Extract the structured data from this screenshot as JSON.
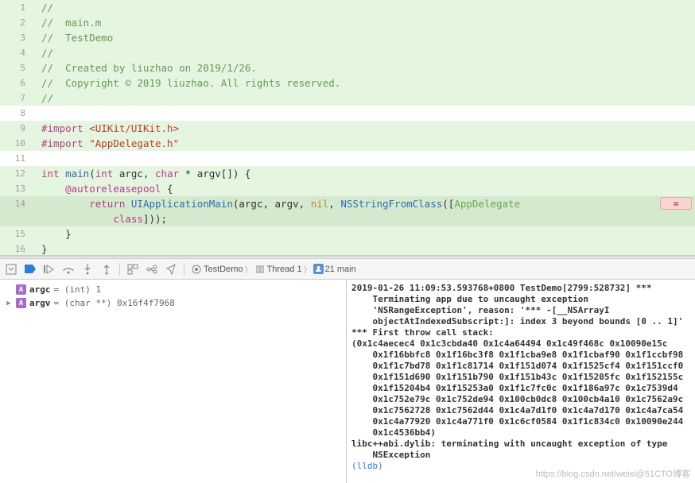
{
  "code": {
    "lines": [
      {
        "n": 1,
        "cls": "green",
        "html": "<span class='comment'>//</span>"
      },
      {
        "n": 2,
        "cls": "green",
        "html": "<span class='comment'>//  main.m</span>"
      },
      {
        "n": 3,
        "cls": "green",
        "html": "<span class='comment'>//  TestDemo</span>"
      },
      {
        "n": 4,
        "cls": "green",
        "html": "<span class='comment'>//</span>"
      },
      {
        "n": 5,
        "cls": "green",
        "html": "<span class='comment'>//  Created by liuzhao on 2019/1/26.</span>"
      },
      {
        "n": 6,
        "cls": "green",
        "html": "<span class='comment'>//  Copyright © 2019 liuzhao. All rights reserved.</span>"
      },
      {
        "n": 7,
        "cls": "green",
        "html": "<span class='comment'>//</span>"
      },
      {
        "n": 8,
        "cls": "",
        "html": ""
      },
      {
        "n": 9,
        "cls": "green",
        "html": "<span class='keyword'>#import</span> <span class='string'>&lt;UIKit/UIKit.h&gt;</span>"
      },
      {
        "n": 10,
        "cls": "green",
        "html": "<span class='keyword'>#import</span> <span class='string'>\"AppDelegate.h\"</span>"
      },
      {
        "n": 11,
        "cls": "",
        "html": ""
      },
      {
        "n": 12,
        "cls": "green",
        "html": "<span class='keyword'>int</span> <span class='func'>main</span>(<span class='keyword'>int</span> argc, <span class='keyword'>char</span> * argv[]) {"
      },
      {
        "n": 13,
        "cls": "green",
        "html": "    <span class='keyword'>@autoreleasepool</span> {"
      },
      {
        "n": 14,
        "cls": "highlight",
        "html": "        <span class='keyword'>return</span> <span class='func'>UIApplicationMain</span>(argc, argv, <span class='kw2'>nil</span>, <span class='func'>NSStringFromClass</span>([<span class='cls'>AppDelegate</span>",
        "err": true
      },
      {
        "n": "",
        "cls": "highlight",
        "html": "            <span class='keyword'>class</span>]));"
      },
      {
        "n": 15,
        "cls": "green",
        "html": "    }"
      },
      {
        "n": 16,
        "cls": "green",
        "html": "}"
      }
    ],
    "err_symbol": "="
  },
  "breadcrumb": {
    "app": "TestDemo",
    "thread": "Thread 1",
    "frame": "21 main"
  },
  "vars": [
    {
      "arrow": "",
      "name": "argc",
      "type": " = (int) ",
      "val": "1"
    },
    {
      "arrow": "▶",
      "name": "argv",
      "type": " = (char **) ",
      "val": "0x16f4f7968"
    }
  ],
  "console": [
    "<b>2019-01-26 11:09:53.593768+0800 TestDemo[2799:528732] ***</b>",
    "<b>    Terminating app due to uncaught exception</b>",
    "<b>    'NSRangeException', reason: '*** -[__NSArrayI</b>",
    "<b>    objectAtIndexedSubscript:]: index 3 beyond bounds [0 .. 1]'</b>",
    "<b>*** First throw call stack:</b>",
    "<b>(0x1c4aecec4 0x1c3cbda40 0x1c4a64494 0x1c49f468c 0x10090e15c</b>",
    "<b>    0x1f16bbfc8 0x1f16bc3f8 0x1f1cba9e8 0x1f1cbaf90 0x1f1ccbf98</b>",
    "<b>    0x1f1c7bd78 0x1f1c81714 0x1f151d074 0x1f1525cf4 0x1f151ccf0</b>",
    "<b>    0x1f151d690 0x1f151b790 0x1f151b43c 0x1f15205fc 0x1f152155c</b>",
    "<b>    0x1f15204b4 0x1f15253a0 0x1f1c7fc0c 0x1f186a97c 0x1c7539d4</b>",
    "<b>    0x1c752e79c 0x1c752de94 0x100cb0dc8 0x100cb4a10 0x1c7562a9c</b>",
    "<b>    0x1c7562728 0x1c7562d44 0x1c4a7d1f0 0x1c4a7d170 0x1c4a7ca54</b>",
    "<b>    0x1c4a77920 0x1c4a771f0 0x1c6cf0584 0x1f1c834c0 0x10090e244</b>",
    "<b>    0x1c4536bb4)</b>",
    "<b>libc++abi.dylib: terminating with uncaught exception of type</b>",
    "<b>    NSException</b>",
    "<span class='lldb'>(lldb)</span> "
  ],
  "watermark": "https://blog.csdn.net/weixi@51CTO博客"
}
